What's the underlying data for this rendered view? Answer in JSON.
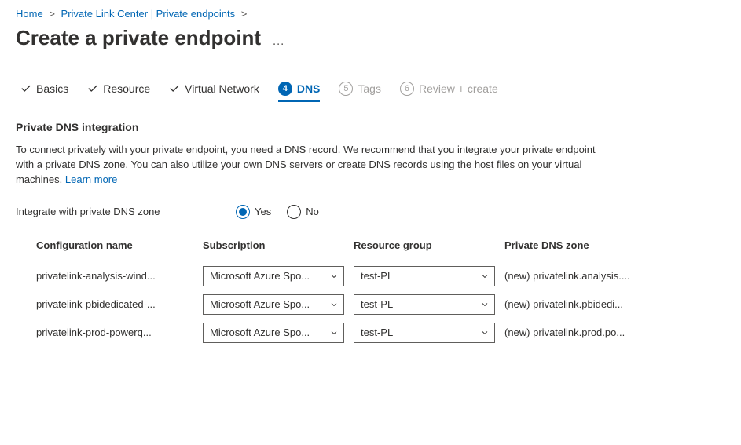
{
  "breadcrumb": {
    "home": "Home",
    "link_center": "Private Link Center | Private endpoints"
  },
  "page_title": "Create a private endpoint",
  "tabs": {
    "basics": "Basics",
    "resource": "Resource",
    "vnet": "Virtual Network",
    "dns_num": "4",
    "dns": "DNS",
    "tags_num": "5",
    "tags": "Tags",
    "review_num": "6",
    "review": "Review + create"
  },
  "dns": {
    "heading": "Private DNS integration",
    "description": "To connect privately with your private endpoint, you need a DNS record. We recommend that you integrate your private endpoint with a private DNS zone. You can also utilize your own DNS servers or create DNS records using the host files on your virtual machines.  ",
    "learn_more": "Learn more",
    "integrate_label": "Integrate with private DNS zone",
    "yes": "Yes",
    "no": "No",
    "columns": {
      "config": "Configuration name",
      "subscription": "Subscription",
      "rg": "Resource group",
      "zone": "Private DNS zone"
    },
    "rows": [
      {
        "config": "privatelink-analysis-wind...",
        "subscription": "Microsoft Azure Spo...",
        "rg": "test-PL",
        "zone": "(new) privatelink.analysis...."
      },
      {
        "config": "privatelink-pbidedicated-...",
        "subscription": "Microsoft Azure Spo...",
        "rg": "test-PL",
        "zone": "(new) privatelink.pbidedi..."
      },
      {
        "config": "privatelink-prod-powerq...",
        "subscription": "Microsoft Azure Spo...",
        "rg": "test-PL",
        "zone": "(new) privatelink.prod.po..."
      }
    ]
  }
}
